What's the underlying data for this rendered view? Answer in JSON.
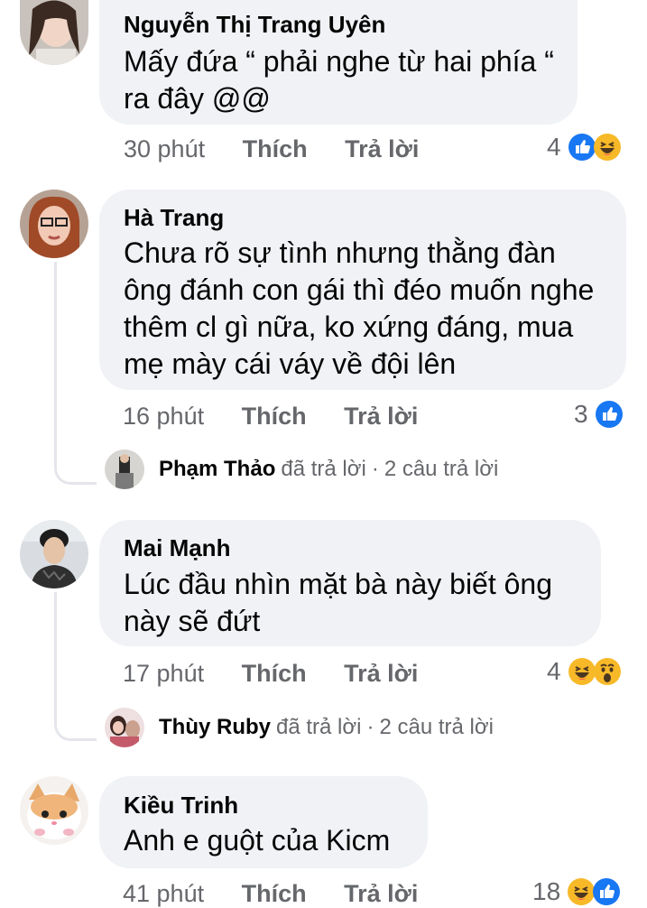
{
  "comments": [
    {
      "author": "Nguyễn Thị Trang Uyên",
      "text": "Mấy đứa “ phải nghe từ hai phía “ ra đây @@",
      "time": "30 phút",
      "like_label": "Thích",
      "reply_label": "Trả lời",
      "reaction_count": "4",
      "reactions": [
        "like-icon",
        "haha-icon"
      ]
    },
    {
      "author": "Hà Trang",
      "text": "Chưa rõ sự tình nhưng thằng đàn ông đánh con gái thì đéo muốn nghe thêm cl gì nữa, ko xứng đáng, mua mẹ mày cái váy về đội lên",
      "time": "16 phút",
      "like_label": "Thích",
      "reply_label": "Trả lời",
      "reaction_count": "3",
      "reactions": [
        "like-icon"
      ],
      "reply_summary": {
        "name": "Phạm Thảo",
        "action": "đã trả lời",
        "separator": "·",
        "count": "2 câu trả lời"
      }
    },
    {
      "author": "Mai Mạnh",
      "text": "Lúc đầu nhìn mặt bà này biết ông này sẽ đứt",
      "time": "17 phút",
      "like_label": "Thích",
      "reply_label": "Trả lời",
      "reaction_count": "4",
      "reactions": [
        "haha-icon",
        "wow-icon"
      ],
      "reply_summary": {
        "name": "Thùy Ruby",
        "action": "đã trả lời",
        "separator": "·",
        "count": "2 câu trả lời"
      }
    },
    {
      "author": "Kiều Trinh",
      "text": "Anh e guột của Kicm",
      "time": "41 phút",
      "like_label": "Thích",
      "reply_label": "Trả lời",
      "reaction_count": "18",
      "reactions": [
        "haha-icon",
        "like-icon"
      ]
    }
  ],
  "colors": {
    "bubble": "#f0f2f5",
    "meta_text": "#65676b",
    "like_blue": "#1877f2",
    "haha_yellow": "#f7b928"
  }
}
